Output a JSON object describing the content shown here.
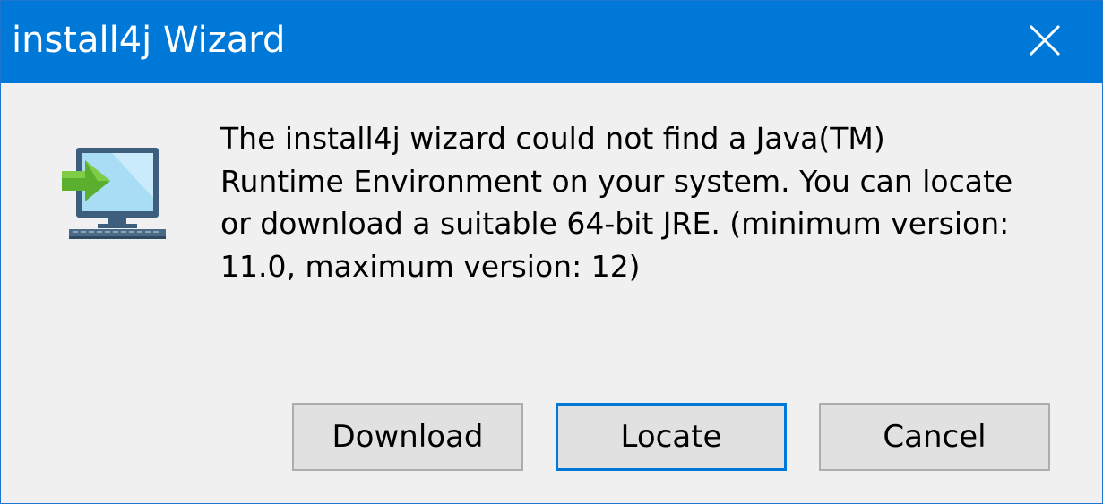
{
  "window": {
    "title": "install4j Wizard",
    "accent_color": "#0078d7"
  },
  "titlebar": {
    "close_icon": "close-icon"
  },
  "dialog": {
    "icon": "computer-install-arrow-icon",
    "message_lines": [
      "The install4j wizard could not find a Java(TM)",
      "Runtime Environment on your system. You can locate",
      "or download a suitable 64-bit JRE. (minimum version:",
      "11.0, maximum version: 12)"
    ]
  },
  "buttons": {
    "download_label": "Download",
    "locate_label": "Locate",
    "cancel_label": "Cancel",
    "default_button": "Locate"
  }
}
